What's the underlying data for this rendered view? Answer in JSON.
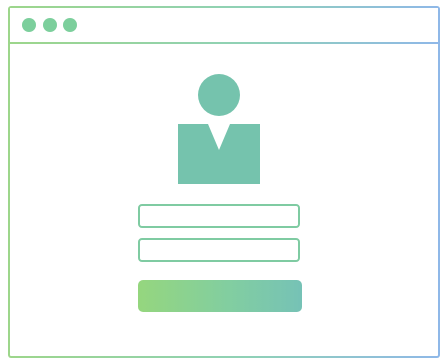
{
  "login_form": {
    "username": {
      "value": "",
      "placeholder": ""
    },
    "password": {
      "value": "",
      "placeholder": ""
    },
    "submit_label": ""
  },
  "colors": {
    "accent_green": "#95d67e",
    "accent_teal": "#75c3ad",
    "frame_blue": "#8fb8e8"
  },
  "icons": {
    "window_controls": [
      "window-dot-icon",
      "window-dot-icon",
      "window-dot-icon"
    ],
    "avatar": "user-avatar-icon"
  }
}
